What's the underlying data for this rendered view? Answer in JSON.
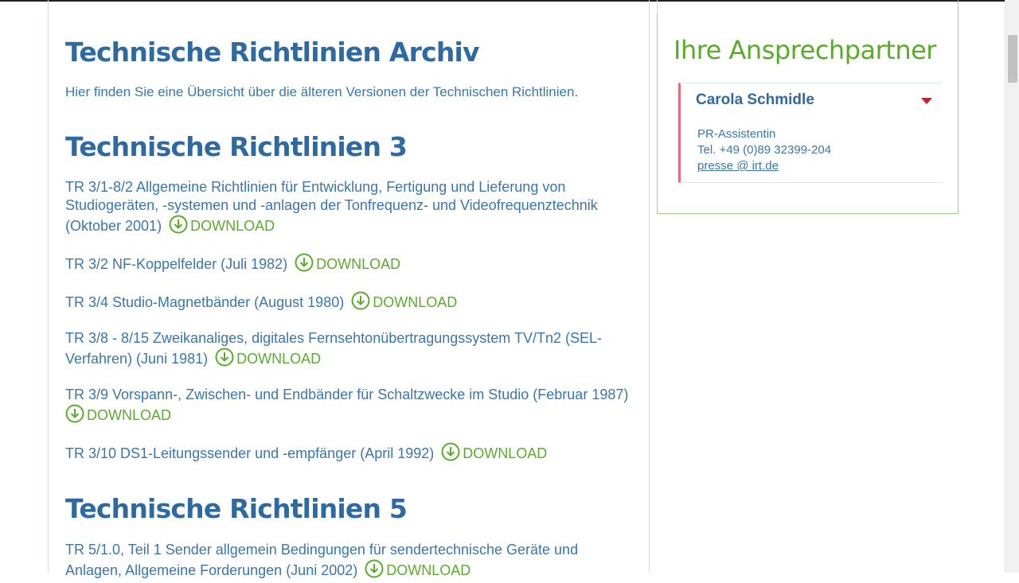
{
  "main": {
    "title": "Technische Richtlinien Archiv",
    "intro": "Hier finden Sie eine Übersicht über die älteren Versionen der Technischen Richtlinien.",
    "download_label": "DOWNLOAD",
    "sections": [
      {
        "title": "Technische Richtlinien 3",
        "entries": [
          {
            "text": "TR 3/1-8/2 Allgemeine Richtlinien für Entwicklung, Fertigung und Lieferung von Studiogeräten, -systemen und -anlagen der Tonfrequenz- und Videofrequenztechnik (Oktober 2001)"
          },
          {
            "text": "TR 3/2 NF-Koppelfelder (Juli 1982)"
          },
          {
            "text": "TR 3/4 Studio-Magnetbänder (August 1980)"
          },
          {
            "text": "TR 3/8 - 8/15 Zweikanaliges, digitales Fernsehtonübertragungssystem TV/Tn2 (SEL-Verfahren) (Juni 1981)"
          },
          {
            "text": "TR 3/9 Vorspann-, Zwischen- und Endbänder für Schaltzwecke im Studio (Februar 1987)"
          },
          {
            "text": "TR 3/10 DS1-Leitungssender und -empfänger (April 1992)"
          }
        ]
      },
      {
        "title": "Technische Richtlinien 5",
        "entries": [
          {
            "text": "TR 5/1.0, Teil 1 Sender allgemein Bedingungen für sendertechnische Geräte und Anlagen, Allgemeine Forderungen (Juni 2002)"
          }
        ]
      }
    ]
  },
  "sidebar": {
    "title": "Ihre Ansprechpartner",
    "contact": {
      "name": "Carola Schmidle",
      "role": "PR-Assistentin",
      "phone": "Tel. +49 (0)89 32399-204",
      "email": "presse @ irt.de"
    }
  },
  "colors": {
    "heading_blue": "#2e6aa1",
    "download_green": "#5aab2c",
    "accent_red": "#d9152b"
  },
  "icons": {
    "download": "download-circle-arrow-icon",
    "toggle": "triangle-down-icon"
  }
}
